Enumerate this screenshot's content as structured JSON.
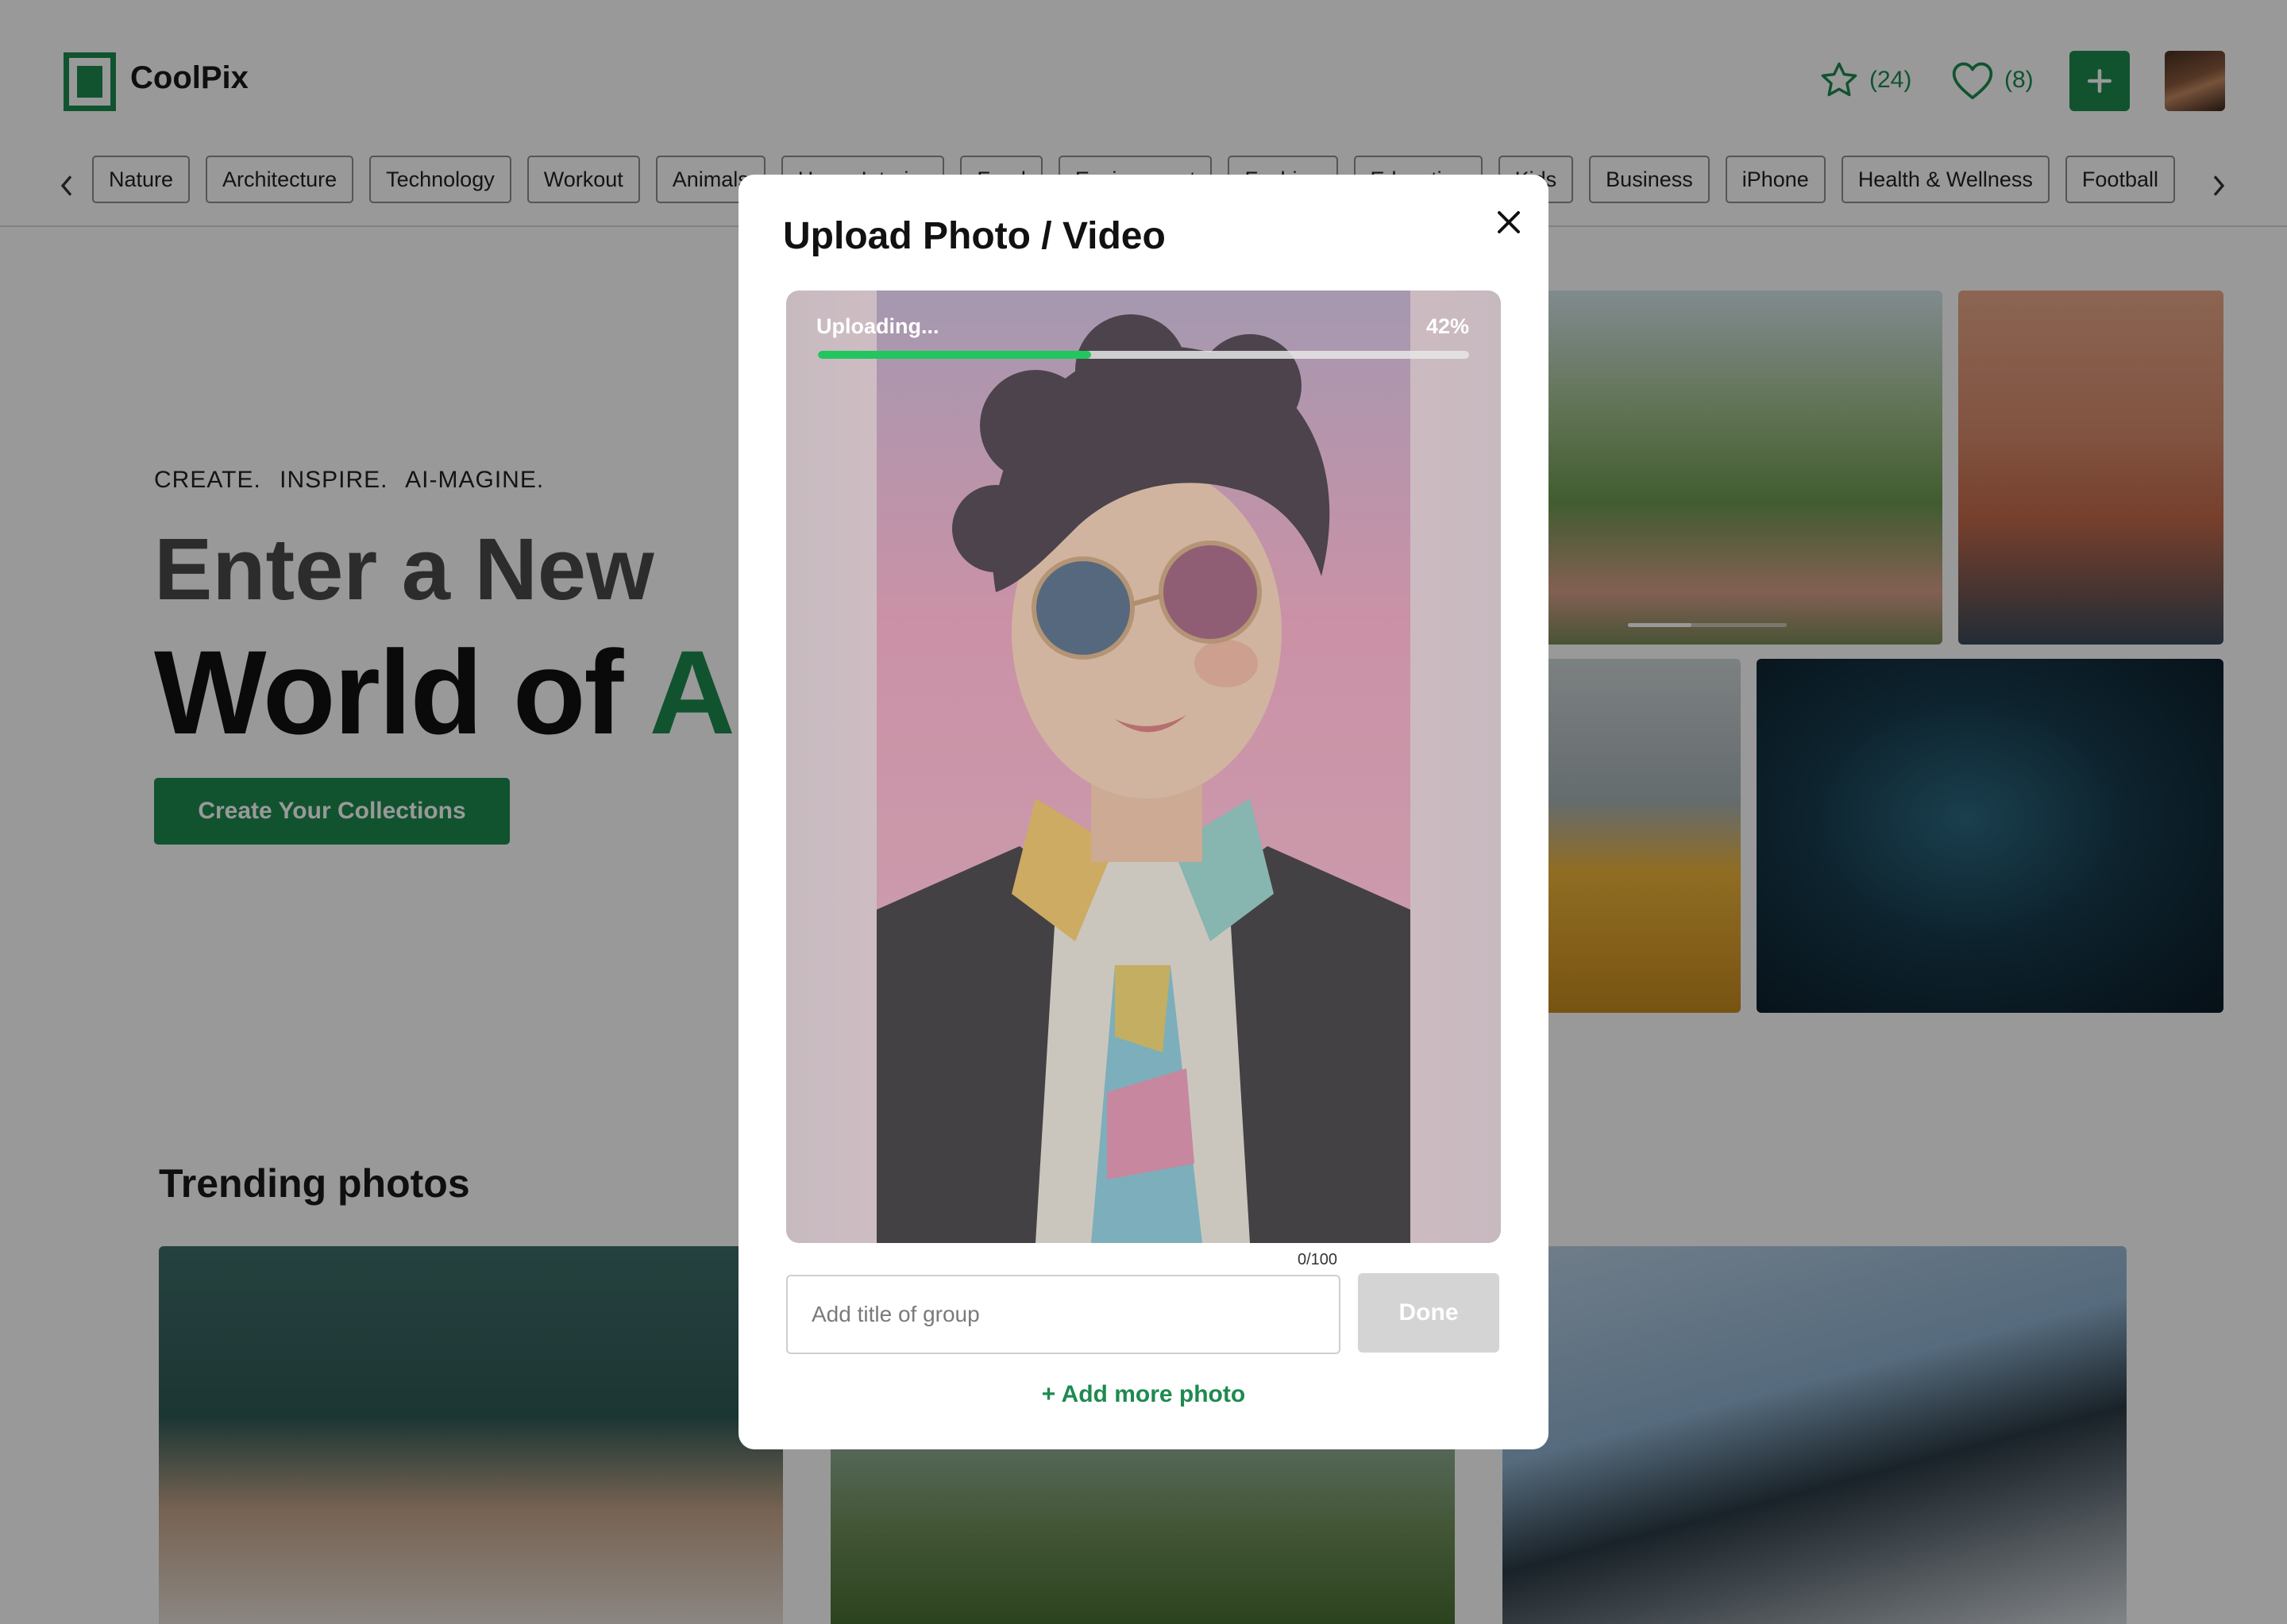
{
  "brand": {
    "name": "CoolPix",
    "accent": "#1d8a4f",
    "progress_color": "#22c55e"
  },
  "header": {
    "favorites_count": "(24)",
    "likes_count": "(8)",
    "icons": {
      "favorites": "star-icon",
      "likes": "heart-icon",
      "add": "plus-icon",
      "prev": "chevron-left-icon",
      "next": "chevron-right-icon",
      "close": "close-icon"
    }
  },
  "categories": [
    "Nature",
    "Architecture",
    "Technology",
    "Workout",
    "Animals",
    "Home Interior",
    "Food",
    "Environment",
    "Fashion",
    "Education",
    "Kids",
    "Business",
    "iPhone",
    "Health & Wellness",
    "Football"
  ],
  "hero": {
    "tagline": "CREATE. INSPIRE. AI-MAGINE.",
    "line1": "Enter a New",
    "line2": "World of",
    "line2_accent": "AI",
    "cta": "Create Your Collections"
  },
  "trending": {
    "title": "Trending photos"
  },
  "modal": {
    "title": "Upload Photo / Video",
    "uploading_label": "Uploading...",
    "progress_percent": "42%",
    "progress_value": 0.42,
    "char_count": "0/100",
    "title_placeholder": "Add title of group",
    "done_label": "Done",
    "add_more_label": "+ Add more photo"
  }
}
